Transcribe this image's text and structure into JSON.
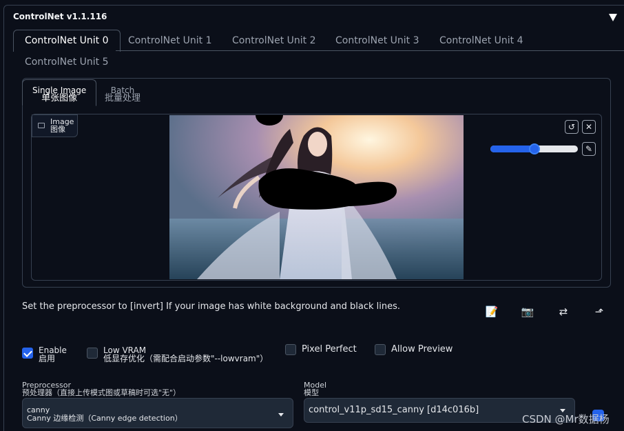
{
  "panel": {
    "title": "ControlNet v1.1.116"
  },
  "unit_tabs": [
    "ControlNet Unit 0",
    "ControlNet Unit 1",
    "ControlNet Unit 2",
    "ControlNet Unit 3",
    "ControlNet Unit 4",
    "ControlNet Unit 5"
  ],
  "mode_tabs": [
    {
      "en": "Single Image",
      "zh": "单张图像",
      "active": true
    },
    {
      "en": "Batch",
      "zh": "批量处理",
      "active": false
    }
  ],
  "image_panel": {
    "label_en": "Image",
    "label_zh": "图像"
  },
  "image_tools": {
    "resolution_slider_value": 0.5
  },
  "hint": "Set the preprocessor to [invert] If your image has white background and black lines.",
  "options": {
    "enable": {
      "en": "Enable",
      "zh": "启用",
      "checked": true
    },
    "low_vram": {
      "en": "Low VRAM",
      "zh": "低显存优化（需配合启动参数\"--lowvram\"）",
      "checked": false
    },
    "pixel_perfect": {
      "label": "Pixel Perfect",
      "checked": false
    },
    "allow_preview": {
      "label": "Allow Preview",
      "checked": false
    }
  },
  "preprocessor": {
    "label_en": "Preprocessor",
    "label_zh": "预处理器（直接上传模式图或草稿时可选\"无\"）",
    "value": "canny",
    "value_desc": "Canny 边缘检测（Canny edge detection）"
  },
  "model": {
    "label_en": "Model",
    "label_zh": "模型",
    "value": "control_v11p_sd15_canny [d14c016b]"
  },
  "watermark": "CSDN @Mr数据杨",
  "colors": {
    "accent": "#2563eb",
    "background": "#0b0f19",
    "border": "#374151"
  }
}
